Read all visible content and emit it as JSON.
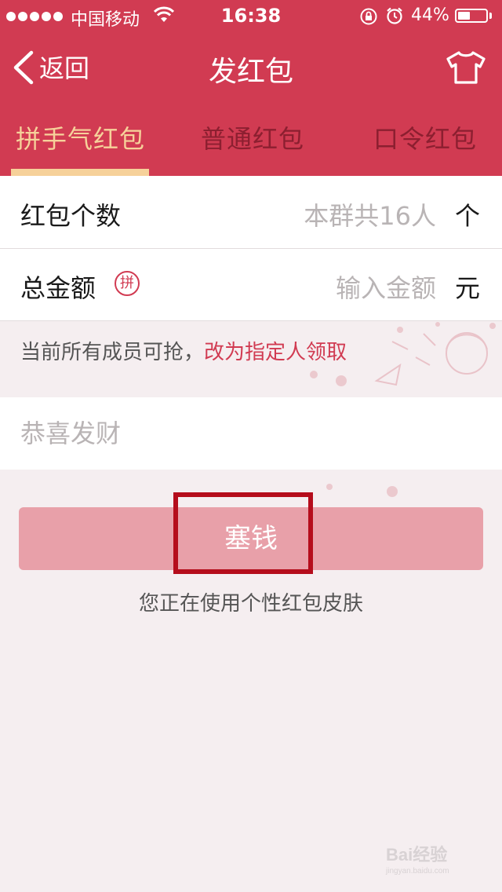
{
  "status_bar": {
    "carrier": "中国移动",
    "time": "16:38",
    "battery_percent": "44%",
    "battery_level": 0.44
  },
  "nav": {
    "back_label": "返回",
    "title": "发红包",
    "right_icon": "tshirt-icon"
  },
  "tabs": [
    {
      "label": "拼手气红包",
      "active": true
    },
    {
      "label": "普通红包",
      "active": false
    },
    {
      "label": "口令红包",
      "active": false
    }
  ],
  "form": {
    "count": {
      "label": "红包个数",
      "placeholder": "本群共16人",
      "unit": "个"
    },
    "amount": {
      "label": "总金额",
      "badge": "拼",
      "placeholder": "输入金额",
      "unit": "元"
    },
    "notice": {
      "text": "当前所有成员可抢，",
      "link": "改为指定人领取"
    },
    "greeting": {
      "placeholder": "恭喜发财"
    }
  },
  "actions": {
    "send_label": "塞钱",
    "skin_note": "您正在使用个性红包皮肤"
  },
  "watermark": {
    "text": "Bai经验",
    "sub": "jingyan.baidu.com"
  },
  "colors": {
    "brand_red": "#d13b52",
    "tab_active": "#f6d19a",
    "button_disabled": "#e8a0a9",
    "highlight": "#b50d1c"
  }
}
